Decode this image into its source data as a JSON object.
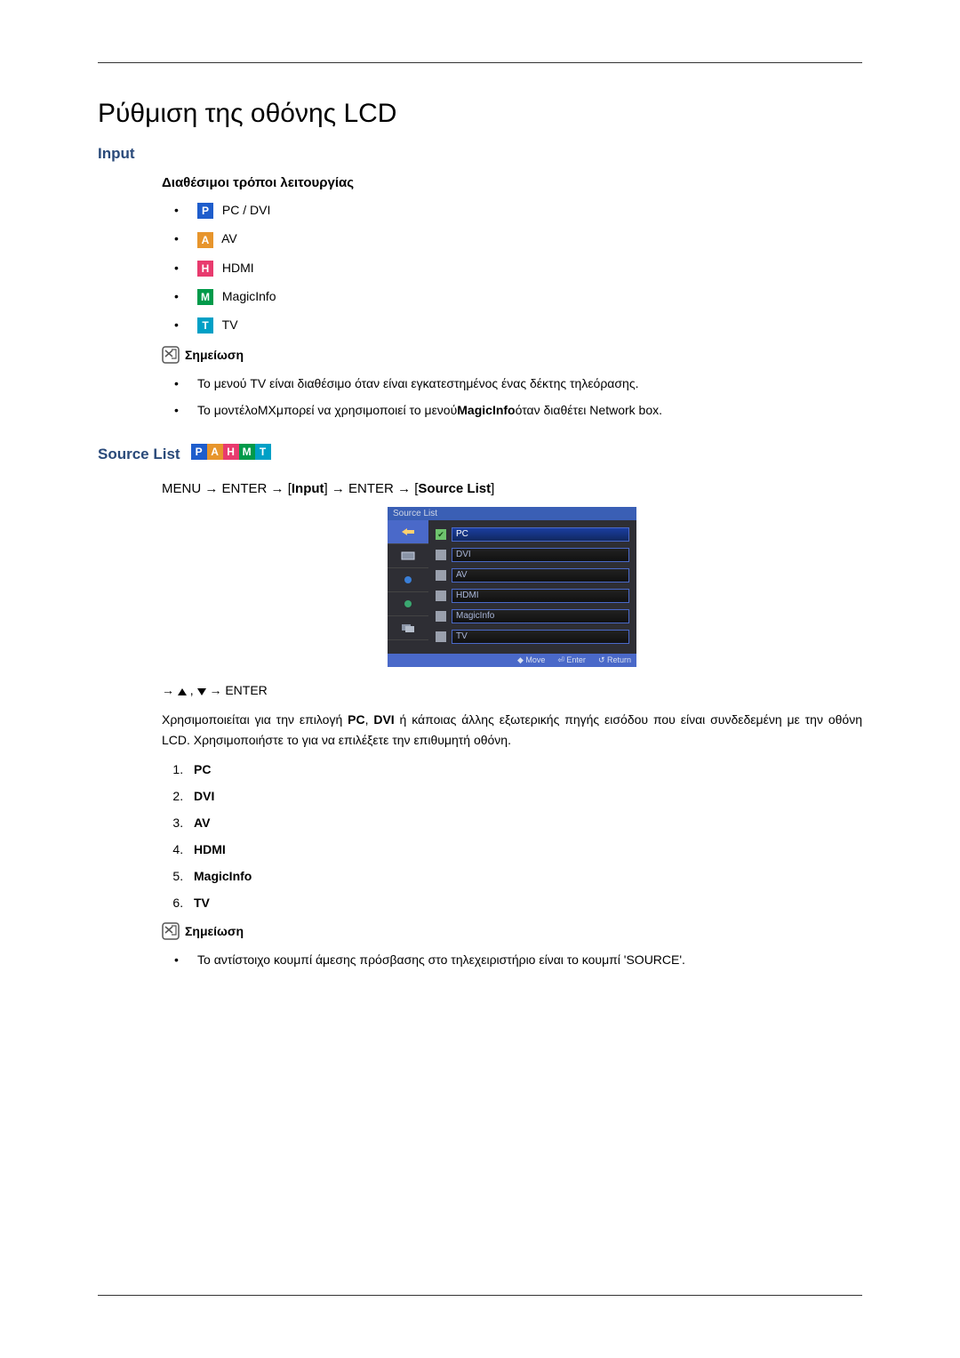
{
  "title": "Ρύθμιση της οθόνης LCD",
  "section_input": "Input",
  "modes_heading": "Διαθέσιμοι τρόποι λειτουργίας",
  "modes": {
    "pc": "PC / DVI",
    "av": "AV",
    "hdmi": "HDMI",
    "magicinfo": "MagicInfo",
    "tv": "TV"
  },
  "mode_letters": {
    "P": "P",
    "A": "A",
    "H": "H",
    "M": "M",
    "T": "T"
  },
  "note_label": "Σημείωση",
  "notes1": {
    "a": "Το μενού TV είναι διαθέσιμο όταν είναι εγκατεστημένος ένας δέκτης τηλεόρασης.",
    "b_pre": "Το μοντέλο",
    "b_mx": "MX",
    "b_mid1": "μπορεί να χρησιμοποιεί το μενού",
    "b_mi": "MagicInfo",
    "b_mid2": "όταν διαθέτει Network box."
  },
  "source_list_label": "Source List",
  "menupath": {
    "menu": "MENU",
    "arrow": "→",
    "enter": "ENTER",
    "input": "Input",
    "source_list": "Source List",
    "lb": "[",
    "rb": "]"
  },
  "osd": {
    "title": "Source List",
    "items": [
      "PC",
      "DVI",
      "AV",
      "HDMI",
      "MagicInfo",
      "TV"
    ],
    "footer_move": "Move",
    "footer_enter": "Enter",
    "footer_return": "Return"
  },
  "nav_line_enter": "ENTER",
  "desc": {
    "pre": "Χρησιμοποιείται για την επιλογή ",
    "pc": "PC",
    "comma": ", ",
    "dvi": "DVI",
    "rest": " ή κάποιας άλλης εξωτερικής πηγής εισόδου που είναι συνδεδεμένη με την οθόνη LCD. Χρησιμοποιήστε το για να επιλέξετε την επιθυμητή οθόνη."
  },
  "numlist": [
    "PC",
    "DVI",
    "AV",
    "HDMI",
    "MagicInfo",
    "TV"
  ],
  "notes2": {
    "a": "Το αντίστοιχο κουμπί άμεσης πρόσβασης στο τηλεχειριστήριο είναι το κουμπί 'SOURCE'."
  }
}
